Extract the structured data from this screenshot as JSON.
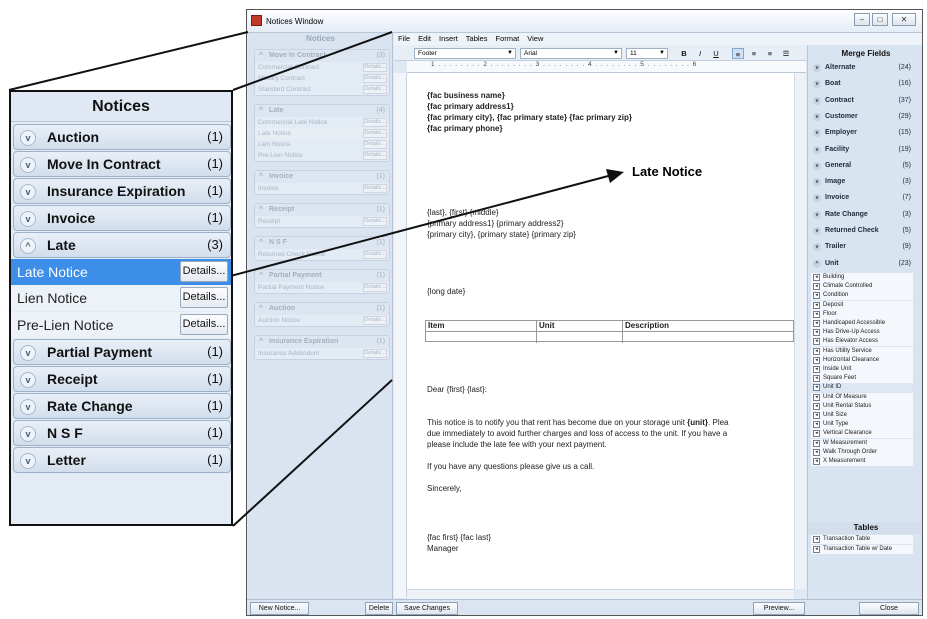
{
  "window": {
    "title": "Notices Window"
  },
  "left_panel": {
    "title": "Notices",
    "groups": [
      {
        "label": "Move In Contract",
        "count": "(3)",
        "items": [
          "Commercial Contract",
          "Military Contract",
          "Standard Contract"
        ]
      },
      {
        "label": "Late",
        "count": "(4)",
        "items": [
          "Commercial Late Notice",
          "Late Notice",
          "Lien Notice",
          "Pre-Lien Notice"
        ]
      },
      {
        "label": "Invoice",
        "count": "(1)",
        "items": [
          "Invoice"
        ]
      },
      {
        "label": "Receipt",
        "count": "(1)",
        "items": [
          "Receipt"
        ]
      },
      {
        "label": "N S F",
        "count": "(1)",
        "items": [
          "Returned Check Notice"
        ]
      },
      {
        "label": "Partial Payment",
        "count": "(1)",
        "items": [
          "Partial Payment Notice"
        ]
      },
      {
        "label": "Auction",
        "count": "(1)",
        "items": [
          "Auction Notice"
        ]
      },
      {
        "label": "Insurance Expiration",
        "count": "(1)",
        "items": [
          "Insurance Addendum"
        ]
      }
    ],
    "details_label": "Details..."
  },
  "menu": [
    "File",
    "Edit",
    "Insert",
    "Tables",
    "Format",
    "View"
  ],
  "toolbar": {
    "style": "Footer",
    "font": "Arial",
    "size": "11",
    "bold": "B",
    "italic": "I",
    "underline": "U"
  },
  "ruler": "1 . . . . . . . . 2 . . . . . . . . 3 . . . . . . . . 4 . . . . . . . . 5 . . . . . . . . 6",
  "document": {
    "header": [
      "{fac business name}",
      "{fac primary address1}",
      "{fac primary city}, {fac primary state}  {fac primary zip}",
      "{fac primary phone}"
    ],
    "address": [
      "{last}, {first} {middle}",
      "{primary address1} {primary address2}",
      "{primary city}, {primary state} {primary zip}"
    ],
    "date": "{long date}",
    "table_headers": [
      "Item",
      "Unit",
      "Description"
    ],
    "greeting": "Dear {first} {last}:",
    "body1_a": "This notice is to notify you that rent has become due on your storage unit ",
    "body1_b": "{unit}",
    "body1_c": ". Plea",
    "body2": "due immediately to avoid further charges and loss of access to the unit.  If you have a",
    "body3": "please include the late fee with your next payment.",
    "body4": "If you have any questions please give us a call.",
    "closing": "Sincerely,",
    "sig1": "{fac first} {fac last}",
    "sig2": "Manager"
  },
  "merge": {
    "title": "Merge Fields",
    "fields": [
      [
        "Alternate",
        "(24)"
      ],
      [
        "Boat",
        "(16)"
      ],
      [
        "Contract",
        "(37)"
      ],
      [
        "Customer",
        "(29)"
      ],
      [
        "Employer",
        "(15)"
      ],
      [
        "Facility",
        "(19)"
      ],
      [
        "General",
        "(5)"
      ],
      [
        "Image",
        "(3)"
      ],
      [
        "Invoice",
        "(7)"
      ],
      [
        "Rate Change",
        "(3)"
      ],
      [
        "Returned Check",
        "(5)"
      ],
      [
        "Trailer",
        "(9)"
      ],
      [
        "Unit",
        "(23)"
      ]
    ],
    "unit_items": [
      "Building",
      "Climate Controlled",
      "Condition",
      "Deposit",
      "Floor",
      "Handicaped Accessible",
      "Has Drive-Up Access",
      "Has Elevator Access",
      "Has Utility Service",
      "Horizontal Clearance",
      "Inside Unit",
      "Square Feet",
      "Unit ID",
      "Unit Of Measure",
      "Unit Rental Status",
      "Unit Size",
      "Unit Type",
      "Vertical Clearance",
      "W Measurement",
      "Walk Through Order",
      "X Measurement"
    ],
    "tables_title": "Tables",
    "tables": [
      "Transaction Table",
      "Transaction Table w/ Date"
    ]
  },
  "status": {
    "new": "New Notice...",
    "delete": "Delete",
    "save": "Save Changes",
    "preview": "Preview...",
    "close": "Close"
  },
  "zoom": {
    "title": "Notices",
    "groups_top": [
      [
        "Auction",
        "(1)"
      ],
      [
        "Move In Contract",
        "(1)"
      ],
      [
        "Insurance Expiration",
        "(1)"
      ],
      [
        "Invoice",
        "(1)"
      ],
      [
        "Late",
        "(3)"
      ]
    ],
    "late_items": [
      "Late Notice",
      "Lien Notice",
      "Pre-Lien Notice"
    ],
    "groups_bottom": [
      [
        "Partial Payment",
        "(1)"
      ],
      [
        "Receipt",
        "(1)"
      ],
      [
        "Rate Change",
        "(1)"
      ],
      [
        "N S F",
        "(1)"
      ],
      [
        "Letter",
        "(1)"
      ]
    ],
    "details": "Details..."
  },
  "annotation": "Late Notice"
}
